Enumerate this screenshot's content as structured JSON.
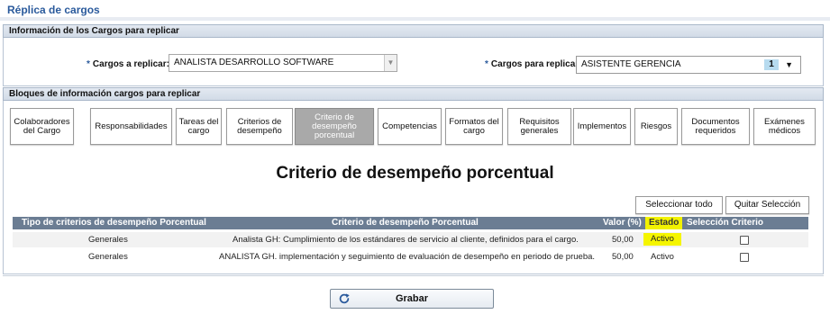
{
  "page": {
    "title": "Réplica de cargos"
  },
  "info_section": {
    "title": "Información de los Cargos para replicar",
    "source_label": "Cargos a replicar:",
    "source_value": "ANALISTA DESARROLLO SOFTWARE",
    "target_label": "Cargos para replicar:",
    "target_value": "ASISTENTE GERENCIA",
    "target_count": "1",
    "required_mark": "*"
  },
  "blocks_section": {
    "title": "Bloques de información cargos para replicar"
  },
  "tabs": [
    {
      "label": "Colaboradores del Cargo"
    },
    {
      "label": "Responsabilidades"
    },
    {
      "label": "Tareas del cargo"
    },
    {
      "label": "Criterios de desempeño"
    },
    {
      "label": "Criterio de desempeño porcentual",
      "active": true
    },
    {
      "label": "Competencias"
    },
    {
      "label": "Formatos del cargo"
    },
    {
      "label": "Requisitos generales"
    },
    {
      "label": "Implementos"
    },
    {
      "label": "Riesgos"
    },
    {
      "label": "Documentos requeridos"
    },
    {
      "label": "Exámenes médicos"
    }
  ],
  "content": {
    "heading": "Criterio de desempeño porcentual",
    "select_all_label": "Seleccionar todo",
    "clear_selection_label": "Quitar Selección"
  },
  "table": {
    "columns": [
      "Tipo de criterios de desempeño Porcentual",
      "Criterio de desempeño Porcentual",
      "Valor (%)",
      "Estado",
      "Selección Criterio Porcentual"
    ],
    "rows": [
      {
        "tipo": "Generales",
        "criterio": "Analista GH: Cumplimiento de los estándares de servicio al cliente, definidos para el cargo.",
        "valor": "50,00",
        "estado": "Activo",
        "selected": false
      },
      {
        "tipo": "Generales",
        "criterio": "ANALISTA GH. implementación y seguimiento de evaluación de desempeño en periodo de prueba.",
        "valor": "50,00",
        "estado": "Activo",
        "selected": false
      }
    ]
  },
  "footer": {
    "save_label": "Grabar"
  },
  "colors": {
    "accent": "#2a5a9c",
    "table_header": "#6b7d93",
    "highlight": "#f5f500",
    "active_tab": "#a9a9a9"
  }
}
